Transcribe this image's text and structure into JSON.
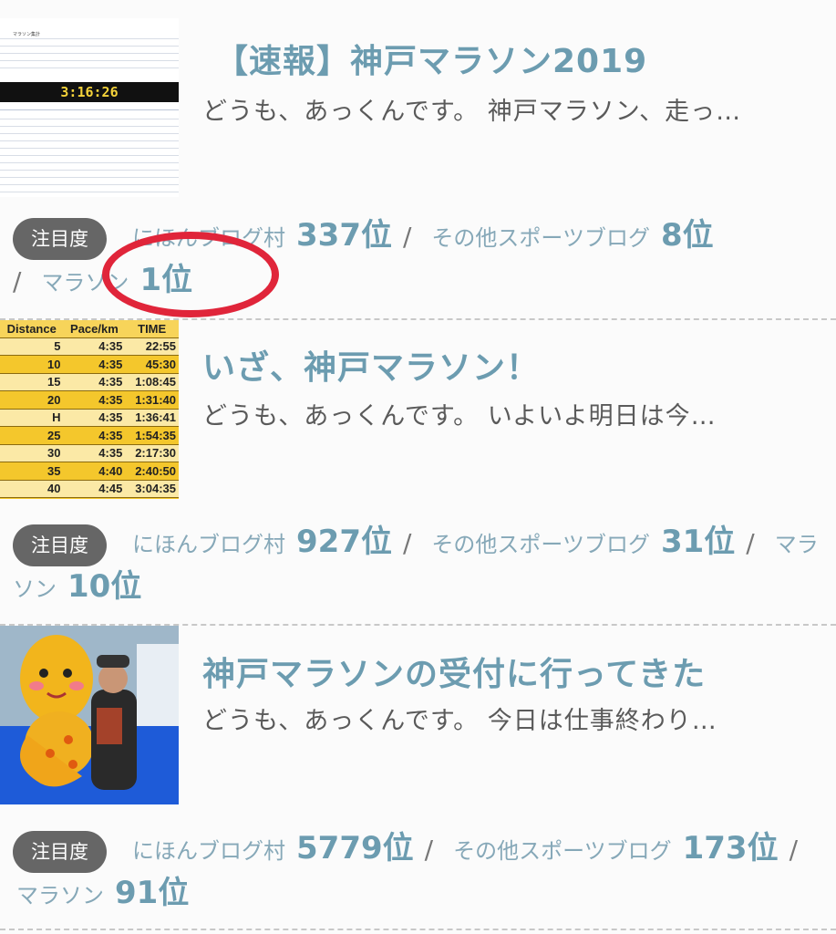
{
  "entries": [
    {
      "title": "【速報】神戸マラソン2019",
      "excerpt": "どうも、あっくんです。 神戸マラソン、走っ…",
      "badge": "注目度",
      "ranks": [
        {
          "category": "にほんブログ村",
          "position": "337位"
        },
        {
          "category": "その他スポーツブログ",
          "position": "8位"
        },
        {
          "category": "マラソン",
          "position": "1位"
        }
      ],
      "thumb_time": "3:16:26"
    },
    {
      "title": "いざ、神戸マラソン！",
      "excerpt": "どうも、あっくんです。 いよいよ明日は今…",
      "badge": "注目度",
      "ranks": [
        {
          "category": "にほんブログ村",
          "position": "927位"
        },
        {
          "category": "その他スポーツブログ",
          "position": "31位"
        },
        {
          "category": "マラソン",
          "position": "10位"
        }
      ],
      "pace_table": {
        "headers": [
          "Distance",
          "Pace/km",
          "TIME"
        ],
        "rows": [
          [
            "5",
            "4:35",
            "22:55"
          ],
          [
            "10",
            "4:35",
            "45:30"
          ],
          [
            "15",
            "4:35",
            "1:08:45"
          ],
          [
            "20",
            "4:35",
            "1:31:40"
          ],
          [
            "H",
            "4:35",
            "1:36:41"
          ],
          [
            "25",
            "4:35",
            "1:54:35"
          ],
          [
            "30",
            "4:35",
            "2:17:30"
          ],
          [
            "35",
            "4:40",
            "2:40:50"
          ],
          [
            "40",
            "4:45",
            "3:04:35"
          ]
        ]
      }
    },
    {
      "title": "神戸マラソンの受付に行ってきた",
      "excerpt": "どうも、あっくんです。 今日は仕事終わり…",
      "badge": "注目度",
      "ranks": [
        {
          "category": "にほんブログ村",
          "position": "5779位"
        },
        {
          "category": "その他スポーツブログ",
          "position": "173位"
        },
        {
          "category": "マラソン",
          "position": "91位"
        }
      ]
    }
  ],
  "colors": {
    "title": "#6c9cb0",
    "badge": "#666666",
    "highlight_circle": "#e0253a"
  }
}
